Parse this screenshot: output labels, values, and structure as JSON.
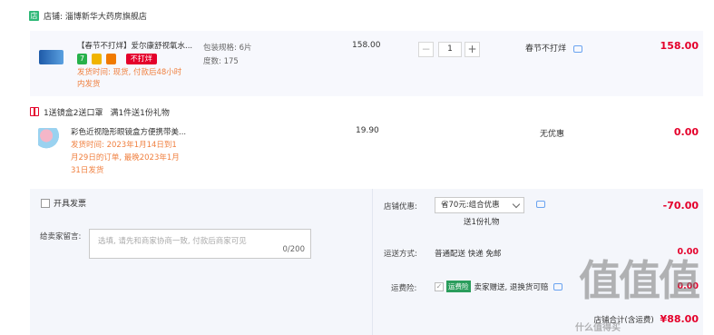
{
  "shop": {
    "icon": "店",
    "name": "店铺: 淄博新华大药房旗舰店"
  },
  "item1": {
    "title": "【春节不打烊】爱尔康舒视氧水...",
    "tag_seven": "7",
    "tag_red": "不打烊",
    "spec_label": "包装规格: 6片",
    "spec_degree": "度数: 175",
    "shipping_note_1": "发货时间: 现货, 付款后48小时",
    "shipping_note_2": "内发货",
    "unit_price": "158.00",
    "quantity": "1",
    "minus": "−",
    "plus": "+",
    "promo": "春节不打烊",
    "subtotal": "158.00"
  },
  "gift": {
    "label": "1送镜盒2送口罩",
    "desc": "满1件送1份礼物"
  },
  "item2": {
    "title": "彩色近视隐形眼镜盒方便携带美...",
    "note_1": "发货时间: 2023年1月14日到1",
    "note_2": "月29日的订单, 最晚2023年1月",
    "note_3": "31日发货",
    "unit_price": "19.90",
    "promo": "无优惠",
    "subtotal": "0.00"
  },
  "footer": {
    "invoice_label": "开具发票",
    "message_label": "给卖家留言:",
    "message_placeholder": "选填, 请先和商家协商一致, 付款后商家可见",
    "message_count": "0/200",
    "discount_label": "店铺优惠:",
    "discount_value": "省70元:组合优惠",
    "discount_gift": "送1份礼物",
    "discount_amount": "-70.00",
    "shipping_label": "运送方式:",
    "shipping_value": "普通配送 快递 免邮",
    "shipping_amount": "0.00",
    "insurance_label": "运费险:",
    "insurance_badge": "运费险",
    "insurance_value": "卖家赠送, 退换货可赔",
    "insurance_amount": "0.00",
    "total_label": "店铺合计(含运费)",
    "total_amount": "¥88.00"
  },
  "watermark": {
    "big": "值值值",
    "small": "什么值得买"
  },
  "colors": {
    "accent_red": "#e4002b",
    "orange": "#f08040",
    "bg_item": "#f7f8fd",
    "shop_green": "#2fb877"
  }
}
